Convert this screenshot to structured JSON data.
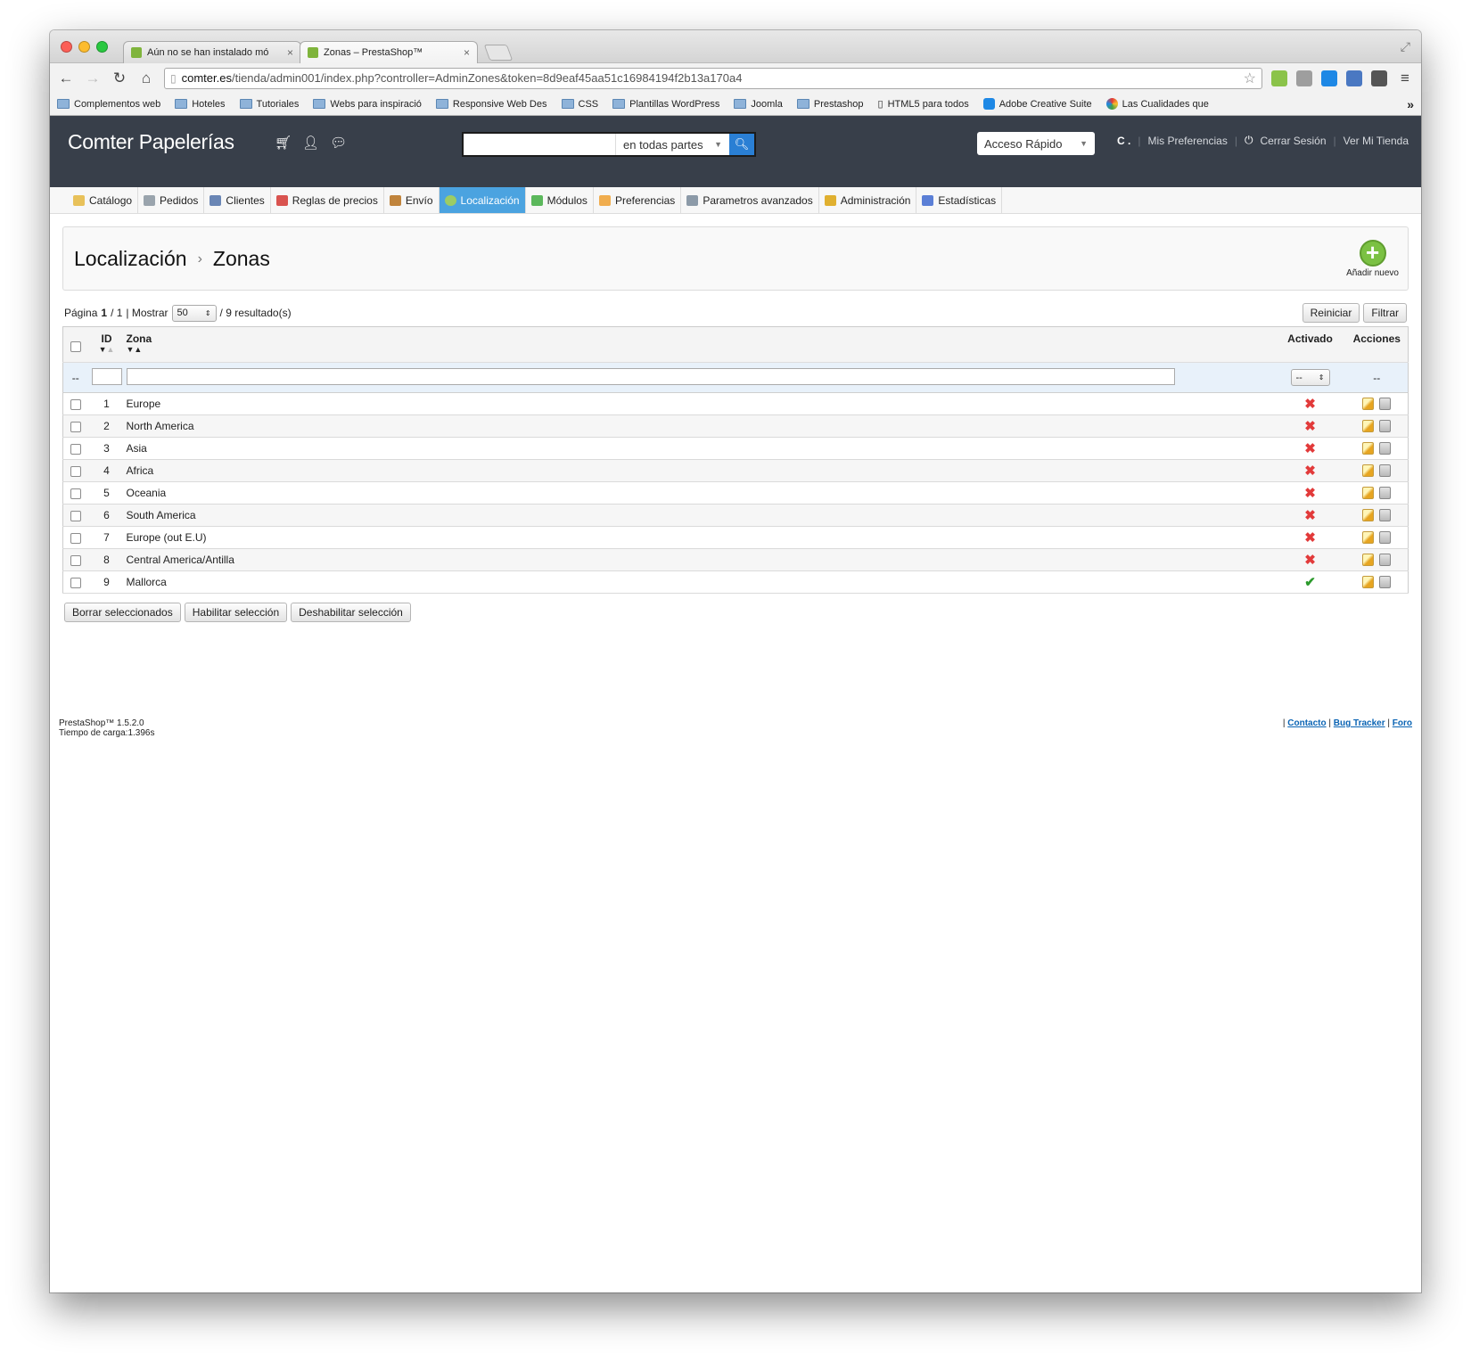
{
  "browser": {
    "tabs": [
      {
        "title": "Aún no se han instalado mó",
        "active": false
      },
      {
        "title": "Zonas – PrestaShop™",
        "active": true
      }
    ],
    "url_host": "comter.es",
    "url_path": "/tienda/admin001/index.php?controller=AdminZones&token=8d9eaf45aa51c16984194f2b13a170a4",
    "bookmarks": [
      "Complementos web",
      "Hoteles",
      "Tutoriales",
      "Webs para inspiració",
      "Responsive Web Des",
      "CSS",
      "Plantillas WordPress",
      "Joomla",
      "Prestashop",
      "HTML5 para todos",
      "Adobe Creative Suite",
      "Las Cualidades que"
    ],
    "bookmarks_more": "»"
  },
  "header": {
    "shop_name": "Comter Papelerías",
    "search_scope": "en todas partes",
    "quick_access": "Acceso Rápido",
    "user": "C .",
    "preferences": "Mis Preferencias",
    "logout": "Cerrar Sesión",
    "view_shop": "Ver Mi Tienda"
  },
  "menu": [
    {
      "label": "Catálogo",
      "color": "#e8c15a"
    },
    {
      "label": "Pedidos",
      "color": "#9aa4ad"
    },
    {
      "label": "Clientes",
      "color": "#6a86b5"
    },
    {
      "label": "Reglas de precios",
      "color": "#d9534f"
    },
    {
      "label": "Envío",
      "color": "#c0843c"
    },
    {
      "label": "Localización",
      "color": "#9ccc65",
      "active": true
    },
    {
      "label": "Módulos",
      "color": "#5cb85c"
    },
    {
      "label": "Preferencias",
      "color": "#f0ad4e"
    },
    {
      "label": "Parametros avanzados",
      "color": "#8c9aa8"
    },
    {
      "label": "Administración",
      "color": "#e0b030"
    },
    {
      "label": "Estadísticas",
      "color": "#5b7fd6"
    }
  ],
  "page": {
    "breadcrumb_parent": "Localización",
    "breadcrumb_current": "Zonas",
    "add_new_label": "Añadir nuevo"
  },
  "list": {
    "page_label": "Página",
    "page_current": "1",
    "page_total": "/ 1",
    "show_label": "| Mostrar",
    "per_page": "50",
    "results": "/ 9 resultado(s)",
    "reset_label": "Reiniciar",
    "filter_label": "Filtrar",
    "columns": {
      "id": "ID",
      "zone": "Zona",
      "active": "Activado",
      "actions": "Acciones"
    },
    "filter_placeholder_dash": "--",
    "rows": [
      {
        "id": "1",
        "zone": "Europe",
        "active": false
      },
      {
        "id": "2",
        "zone": "North America",
        "active": false
      },
      {
        "id": "3",
        "zone": "Asia",
        "active": false
      },
      {
        "id": "4",
        "zone": "Africa",
        "active": false
      },
      {
        "id": "5",
        "zone": "Oceania",
        "active": false
      },
      {
        "id": "6",
        "zone": "South America",
        "active": false
      },
      {
        "id": "7",
        "zone": "Europe (out E.U)",
        "active": false
      },
      {
        "id": "8",
        "zone": "Central America/Antilla",
        "active": false
      },
      {
        "id": "9",
        "zone": "Mallorca",
        "active": true
      }
    ],
    "bulk": {
      "delete": "Borrar seleccionados",
      "enable": "Habilitar selección",
      "disable": "Deshabilitar selección"
    }
  },
  "footer": {
    "version": "PrestaShop™ 1.5.2.0",
    "load_time": "Tiempo de carga:1.396s",
    "links": [
      "Contacto",
      "Bug Tracker",
      "Foro"
    ]
  }
}
